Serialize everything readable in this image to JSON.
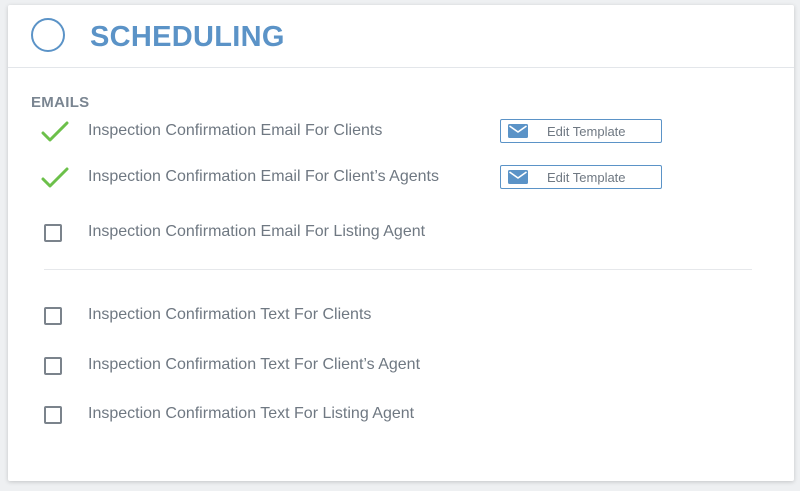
{
  "header": {
    "title": "SCHEDULING"
  },
  "emails": {
    "section_label": "EMAILS",
    "items": [
      {
        "label": "Inspection Confirmation Email For Clients",
        "checked": true,
        "button_label": "Edit Template"
      },
      {
        "label": "Inspection Confirmation Email For Client’s Agents",
        "checked": true,
        "button_label": "Edit Template"
      },
      {
        "label": "Inspection Confirmation Email For Listing Agent",
        "checked": false
      }
    ]
  },
  "texts": {
    "items": [
      {
        "label": "Inspection Confirmation Text For Clients",
        "checked": false
      },
      {
        "label": "Inspection Confirmation Text For Client’s Agent",
        "checked": false
      },
      {
        "label": "Inspection Confirmation Text For Listing Agent",
        "checked": false
      }
    ]
  },
  "colors": {
    "accent": "#5b93c7",
    "check": "#6cc04a",
    "text": "#6f7882"
  },
  "icons": {
    "check": "checkmark-icon",
    "mail": "envelope-icon"
  }
}
